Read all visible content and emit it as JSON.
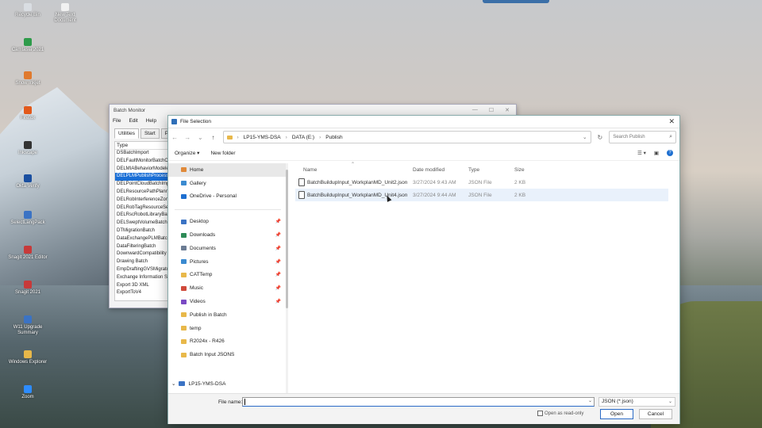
{
  "desktop": {
    "icons": [
      {
        "label": "Recycle Bin",
        "color": "#d9dde2"
      },
      {
        "label": "New Text Document",
        "color": "#f1f1f1"
      },
      {
        "label": "Camtasia 2021",
        "color": "#2e9b4a"
      },
      {
        "label": "Snow Inkjet",
        "color": "#e07a2e"
      },
      {
        "label": "Firefox",
        "color": "#e25a1c"
      },
      {
        "label": "Inkscape",
        "color": "#333333"
      },
      {
        "label": "Okta Verify",
        "color": "#1a4fa0"
      },
      {
        "label": "SelectLangPack",
        "color": "#3b73c4"
      },
      {
        "label": "Snagit 2021 Editor",
        "color": "#c73a3a"
      },
      {
        "label": "Snagit 2021",
        "color": "#c73a3a"
      },
      {
        "label": "W11 Upgrade Summary",
        "color": "#3b73c4"
      },
      {
        "label": "Windows Explorer",
        "color": "#e8b84a"
      },
      {
        "label": "Zoom",
        "color": "#2d8cff"
      }
    ]
  },
  "batch_monitor": {
    "title": "Batch Monitor",
    "menu": [
      "File",
      "Edit",
      "Help"
    ],
    "tabs": [
      "Utilities",
      "Start",
      "Pro"
    ],
    "list_header": "Type",
    "items": [
      "DSBatchImport",
      "DELFaultMonitorBatchCo",
      "DELMIABehaviorModeler",
      "DELPLMPublishProcessBa",
      "DELPointCloudBatchImpo",
      "DELResourcePathPlanning",
      "DELRobInterferenceZone",
      "DELRobTagResourceSetBa",
      "DELRscRobotLibraryBatch",
      "DELSweptVolumeBatchCo",
      "DTMigrationBatch",
      "DataExchangePLMBatch",
      "DataFilteringBatch",
      "DownwardCompatibility",
      "Drawing Batch",
      "EmpDraftingGVSMigrator",
      "Exchange Information Sy",
      "Export 3D XML",
      "ExportToV4"
    ],
    "selected_index": 3
  },
  "file_dialog": {
    "title": "File Selection",
    "breadcrumb": [
      "LP15-YMS-DSA",
      "DATA (E:)",
      "Publish"
    ],
    "search_placeholder": "Search Publish",
    "organize_label": "Organize",
    "new_folder_label": "New folder",
    "nav": {
      "top": [
        {
          "label": "Home",
          "icon": "home-icon",
          "color": "#e08a3a",
          "selected": true
        },
        {
          "label": "Gallery",
          "icon": "gallery-icon",
          "color": "#3a8ad0"
        },
        {
          "label": "OneDrive - Personal",
          "icon": "onedrive-icon",
          "color": "#1e6fd0"
        }
      ],
      "quick": [
        {
          "label": "Desktop",
          "icon": "desktop-icon",
          "color": "#3b73c4",
          "pinned": true
        },
        {
          "label": "Downloads",
          "icon": "downloads-icon",
          "color": "#2e8b57",
          "pinned": true
        },
        {
          "label": "Documents",
          "icon": "documents-icon",
          "color": "#6b7c93",
          "pinned": true
        },
        {
          "label": "Pictures",
          "icon": "pictures-icon",
          "color": "#3a8ad0",
          "pinned": true
        },
        {
          "label": "CATTemp",
          "icon": "folder-icon",
          "color": "#e8b84a",
          "pinned": true
        },
        {
          "label": "Music",
          "icon": "music-icon",
          "color": "#d04a3a",
          "pinned": true
        },
        {
          "label": "Videos",
          "icon": "videos-icon",
          "color": "#7a4ac4",
          "pinned": true
        },
        {
          "label": "Publish in Batch",
          "icon": "folder-icon",
          "color": "#e8b84a"
        },
        {
          "label": "temp",
          "icon": "folder-icon",
          "color": "#e8b84a"
        },
        {
          "label": "R2024x - R426",
          "icon": "folder-icon",
          "color": "#e8b84a"
        },
        {
          "label": "Batch Input JSONS",
          "icon": "folder-icon",
          "color": "#e8b84a"
        }
      ],
      "computer": "LP15-YMS-DSA"
    },
    "columns": {
      "name": "Name",
      "date": "Date modified",
      "type": "Type",
      "size": "Size"
    },
    "files": [
      {
        "name": "BatchBuildupInput_WorkplanMD_Unit2.json",
        "date": "3/27/2024 9:43 AM",
        "type": "JSON File",
        "size": "2 KB"
      },
      {
        "name": "BatchBuildupInput_WorkplanMD_Unit4.json",
        "date": "3/27/2024 9:44 AM",
        "type": "JSON File",
        "size": "2 KB"
      }
    ],
    "file_name_label": "File name:",
    "file_name_value": "",
    "file_type_value": "JSON (*.json)",
    "readonly_label": "Open as read-only",
    "open_label": "Open",
    "cancel_label": "Cancel"
  }
}
